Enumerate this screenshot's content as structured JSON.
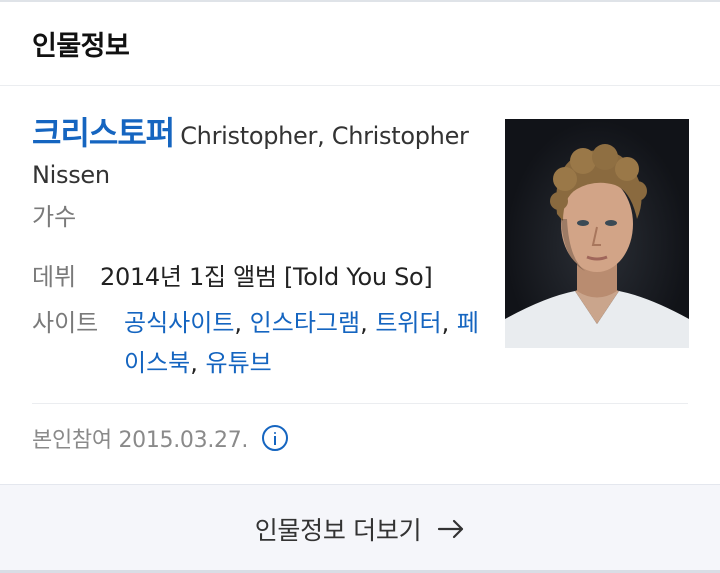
{
  "header": {
    "title": "인물정보"
  },
  "profile": {
    "name_ko": "크리스토퍼",
    "name_en": "Christopher, Christopher Nissen",
    "occupation": "가수",
    "debut_label": "데뷔",
    "debut_value": "2014년 1집 앨범 [Told You So]",
    "site_label": "사이트",
    "sites": [
      "공식사이트",
      "인스타그램",
      "트위터",
      "페이스북",
      "유튜브"
    ],
    "separator": ", ",
    "photo_icon": "person-photo"
  },
  "participation": {
    "text": "본인참여 2015.03.27.",
    "icon": "info-icon"
  },
  "footer": {
    "more_label": "인물정보 더보기",
    "icon": "arrow-right-icon"
  },
  "colors": {
    "link": "#1565c0",
    "muted": "#7a7a7a",
    "footer_bg": "#f5f6fa"
  }
}
